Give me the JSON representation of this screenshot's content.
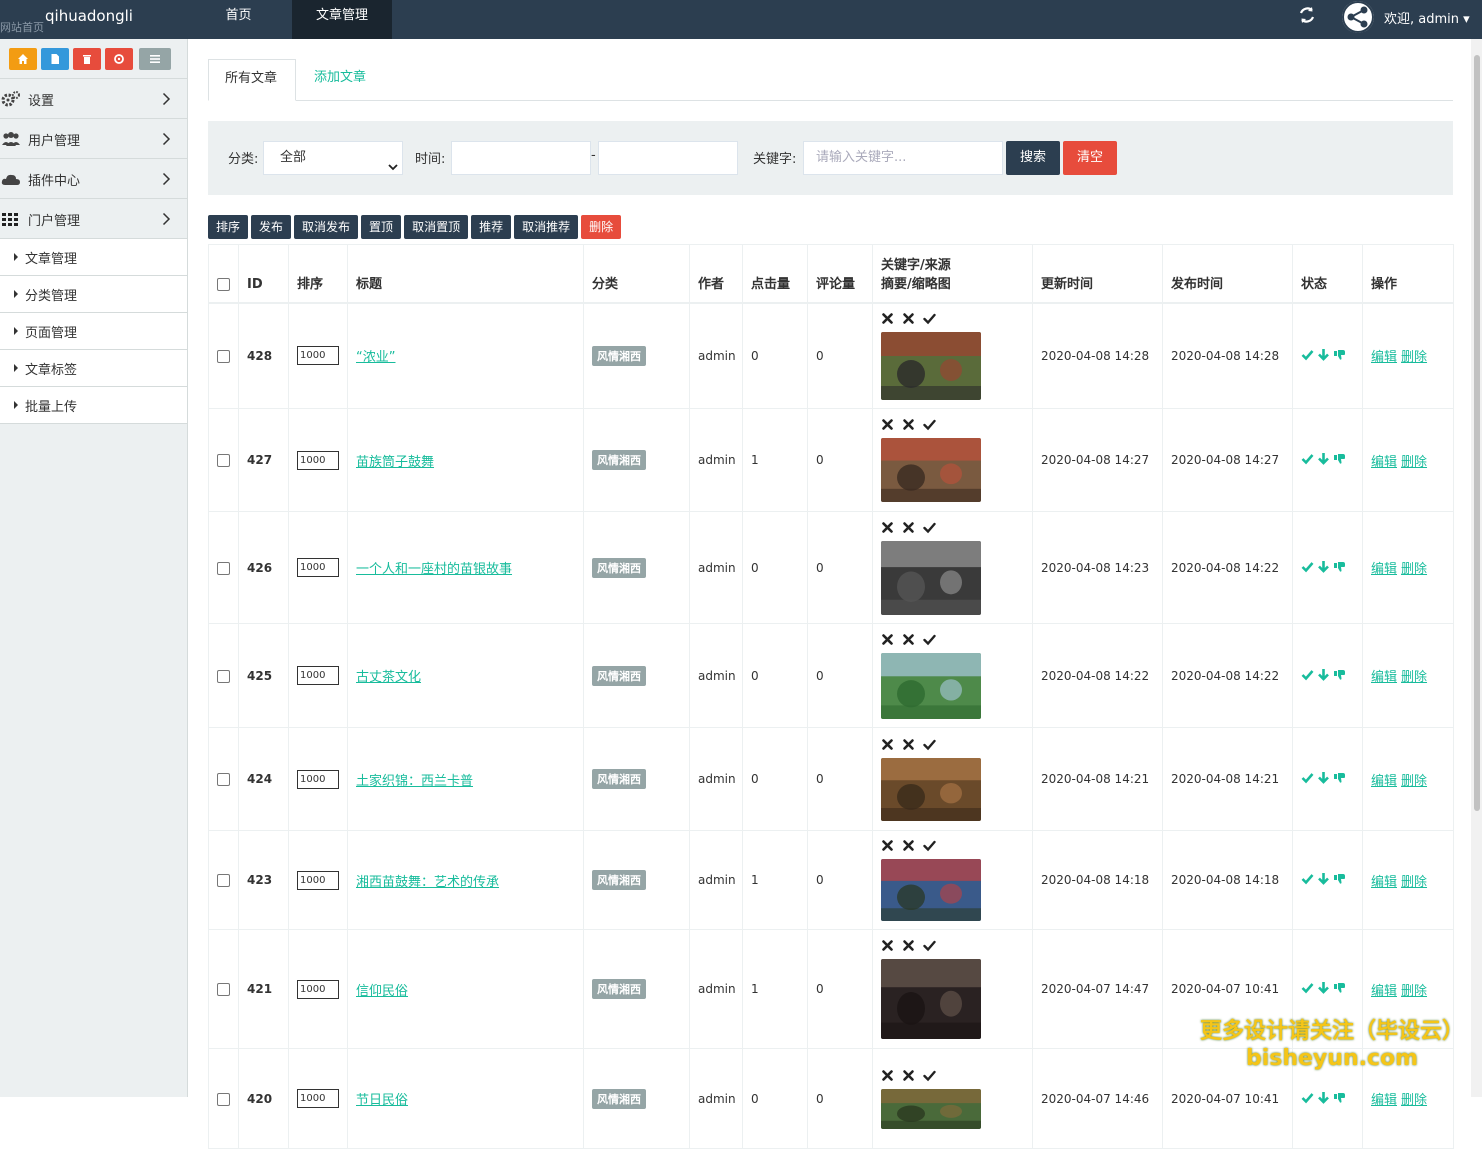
{
  "topbar": {
    "brand": "qihuadongli",
    "brand_tip": "网站首页",
    "nav": [
      "首页",
      "文章管理"
    ],
    "welcome": "欢迎, admin ▾",
    "icons": [
      "refresh-icon",
      "avatar-share-icon"
    ]
  },
  "sidebar": {
    "shortcut_icons": [
      "home-icon",
      "file-icon",
      "trash-icon",
      "recycle-icon",
      "list-icon"
    ],
    "shortcut_colors": [
      "#f39c12",
      "#3498db",
      "#e74c3c",
      "#e74c3c",
      "#95a5a6"
    ],
    "menu": [
      {
        "label": "设置",
        "icon": "gears-icon"
      },
      {
        "label": "用户管理",
        "icon": "users-icon"
      },
      {
        "label": "插件中心",
        "icon": "cloud-icon"
      },
      {
        "label": "门户管理",
        "icon": "grid-icon"
      }
    ],
    "submenu": [
      "文章管理",
      "分类管理",
      "页面管理",
      "文章标签",
      "批量上传"
    ]
  },
  "tabs": [
    "所有文章",
    "添加文章"
  ],
  "filter": {
    "category_label": "分类:",
    "category_value": "全部",
    "time_label": "时间:",
    "time_separator": "-",
    "keyword_label": "关键字:",
    "keyword_placeholder": "请输入关键字...",
    "search_btn": "搜索",
    "clear_btn": "清空"
  },
  "toolbar": [
    "排序",
    "发布",
    "取消发布",
    "置顶",
    "取消置顶",
    "推荐",
    "取消推荐",
    "删除"
  ],
  "table": {
    "headers": {
      "id": "ID",
      "order": "排序",
      "title": "标题",
      "category": "分类",
      "author": "作者",
      "hits": "点击量",
      "comments": "评论量",
      "kw_line1": "关键字/来源",
      "kw_line2": "摘要/缩略图",
      "updated": "更新时间",
      "published": "发布时间",
      "status": "状态",
      "actions": "操作"
    },
    "rows": [
      {
        "id": "428",
        "order": "1000",
        "title": "“浓业”",
        "category": "风情湘西",
        "author": "admin",
        "hits": "0",
        "comments": "0",
        "updated": "2020-04-08 14:28",
        "published": "2020-04-08 14:28",
        "edit": "编辑",
        "delete": "删除"
      },
      {
        "id": "427",
        "order": "1000",
        "title": "苗族筒子鼓舞",
        "category": "风情湘西",
        "author": "admin",
        "hits": "1",
        "comments": "0",
        "updated": "2020-04-08 14:27",
        "published": "2020-04-08 14:27",
        "edit": "编辑",
        "delete": "删除"
      },
      {
        "id": "426",
        "order": "1000",
        "title": "一个人和一座村的苗银故事",
        "category": "风情湘西",
        "author": "admin",
        "hits": "0",
        "comments": "0",
        "updated": "2020-04-08 14:23",
        "published": "2020-04-08 14:22",
        "edit": "编辑",
        "delete": "删除"
      },
      {
        "id": "425",
        "order": "1000",
        "title": "古丈茶文化",
        "category": "风情湘西",
        "author": "admin",
        "hits": "0",
        "comments": "0",
        "updated": "2020-04-08 14:22",
        "published": "2020-04-08 14:22",
        "edit": "编辑",
        "delete": "删除"
      },
      {
        "id": "424",
        "order": "1000",
        "title": "土家织锦：西兰卡普",
        "category": "风情湘西",
        "author": "admin",
        "hits": "0",
        "comments": "0",
        "updated": "2020-04-08 14:21",
        "published": "2020-04-08 14:21",
        "edit": "编辑",
        "delete": "删除"
      },
      {
        "id": "423",
        "order": "1000",
        "title": "湘西苗鼓舞：艺术的传承",
        "category": "风情湘西",
        "author": "admin",
        "hits": "1",
        "comments": "0",
        "updated": "2020-04-08 14:18",
        "published": "2020-04-08 14:18",
        "edit": "编辑",
        "delete": "删除"
      },
      {
        "id": "421",
        "order": "1000",
        "title": "信仰民俗",
        "category": "风情湘西",
        "author": "admin",
        "hits": "1",
        "comments": "0",
        "updated": "2020-04-07 14:47",
        "published": "2020-04-07 10:41",
        "edit": "编辑",
        "delete": "删除"
      },
      {
        "id": "420",
        "order": "1000",
        "title": "节日民俗",
        "category": "风情湘西",
        "author": "admin",
        "hits": "0",
        "comments": "0",
        "updated": "2020-04-07 14:46",
        "published": "2020-04-07 10:41",
        "edit": "编辑",
        "delete": "删除"
      }
    ]
  },
  "watermark": {
    "line1": "更多设计请关注（毕设云）",
    "line2": "bisheyun.com"
  },
  "colors": {
    "dark": "#2c3e50",
    "accent": "#18bc9c",
    "danger": "#e74c3c",
    "grey": "#95a5a6",
    "sidebar_bg": "#ecf0f1"
  }
}
